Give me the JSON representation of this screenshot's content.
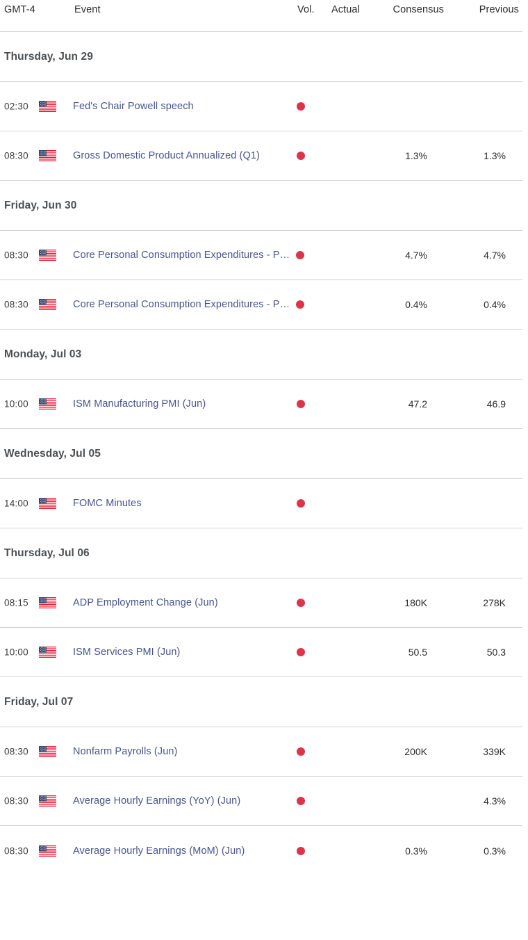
{
  "header": {
    "timezone_label": "GMT-4",
    "event_label": "Event",
    "vol_label": "Vol.",
    "actual_label": "Actual",
    "consensus_label": "Consensus",
    "previous_label": "Previous"
  },
  "colors": {
    "event_link": "#46548c",
    "volatility_high": "#dc3448",
    "day_header_text": "#4b4f52",
    "separator": "#cfd3d6",
    "background": "#ffffff"
  },
  "icons": {
    "flag": "us-flag-icon",
    "volatility": "volatility-high-dot-icon"
  },
  "sections": [
    {
      "day": "Thursday, Jun 29",
      "events": [
        {
          "time": "02:30",
          "country": "US",
          "name": "Fed's Chair Powell speech",
          "truncated": false,
          "volatility": "high",
          "actual": "",
          "consensus": "",
          "previous": ""
        },
        {
          "time": "08:30",
          "country": "US",
          "name": "Gross Domestic Product Annualized (Q1)",
          "truncated": false,
          "volatility": "high",
          "actual": "",
          "consensus": "1.3%",
          "previous": "1.3%"
        }
      ]
    },
    {
      "day": "Friday, Jun 30",
      "events": [
        {
          "time": "08:30",
          "country": "US",
          "name": "Core Personal Consumption Expenditures - P…",
          "truncated": true,
          "volatility": "high",
          "actual": "",
          "consensus": "4.7%",
          "previous": "4.7%"
        },
        {
          "time": "08:30",
          "country": "US",
          "name": "Core Personal Consumption Expenditures - P…",
          "truncated": true,
          "volatility": "high",
          "actual": "",
          "consensus": "0.4%",
          "previous": "0.4%"
        }
      ]
    },
    {
      "day": "Monday, Jul 03",
      "events": [
        {
          "time": "10:00",
          "country": "US",
          "name": "ISM Manufacturing PMI (Jun)",
          "truncated": false,
          "volatility": "high",
          "actual": "",
          "consensus": "47.2",
          "previous": "46.9"
        }
      ]
    },
    {
      "day": "Wednesday, Jul 05",
      "events": [
        {
          "time": "14:00",
          "country": "US",
          "name": "FOMC Minutes",
          "truncated": false,
          "volatility": "high",
          "actual": "",
          "consensus": "",
          "previous": ""
        }
      ]
    },
    {
      "day": "Thursday, Jul 06",
      "events": [
        {
          "time": "08:15",
          "country": "US",
          "name": "ADP Employment Change (Jun)",
          "truncated": false,
          "volatility": "high",
          "actual": "",
          "consensus": "180K",
          "previous": "278K"
        },
        {
          "time": "10:00",
          "country": "US",
          "name": "ISM Services PMI (Jun)",
          "truncated": false,
          "volatility": "high",
          "actual": "",
          "consensus": "50.5",
          "previous": "50.3"
        }
      ]
    },
    {
      "day": "Friday, Jul 07",
      "events": [
        {
          "time": "08:30",
          "country": "US",
          "name": "Nonfarm Payrolls (Jun)",
          "truncated": false,
          "volatility": "high",
          "actual": "",
          "consensus": "200K",
          "previous": "339K"
        },
        {
          "time": "08:30",
          "country": "US",
          "name": "Average Hourly Earnings (YoY) (Jun)",
          "truncated": false,
          "volatility": "high",
          "actual": "",
          "consensus": "",
          "previous": "4.3%"
        },
        {
          "time": "08:30",
          "country": "US",
          "name": "Average Hourly Earnings (MoM) (Jun)",
          "truncated": false,
          "volatility": "high",
          "actual": "",
          "consensus": "0.3%",
          "previous": "0.3%"
        }
      ]
    }
  ]
}
